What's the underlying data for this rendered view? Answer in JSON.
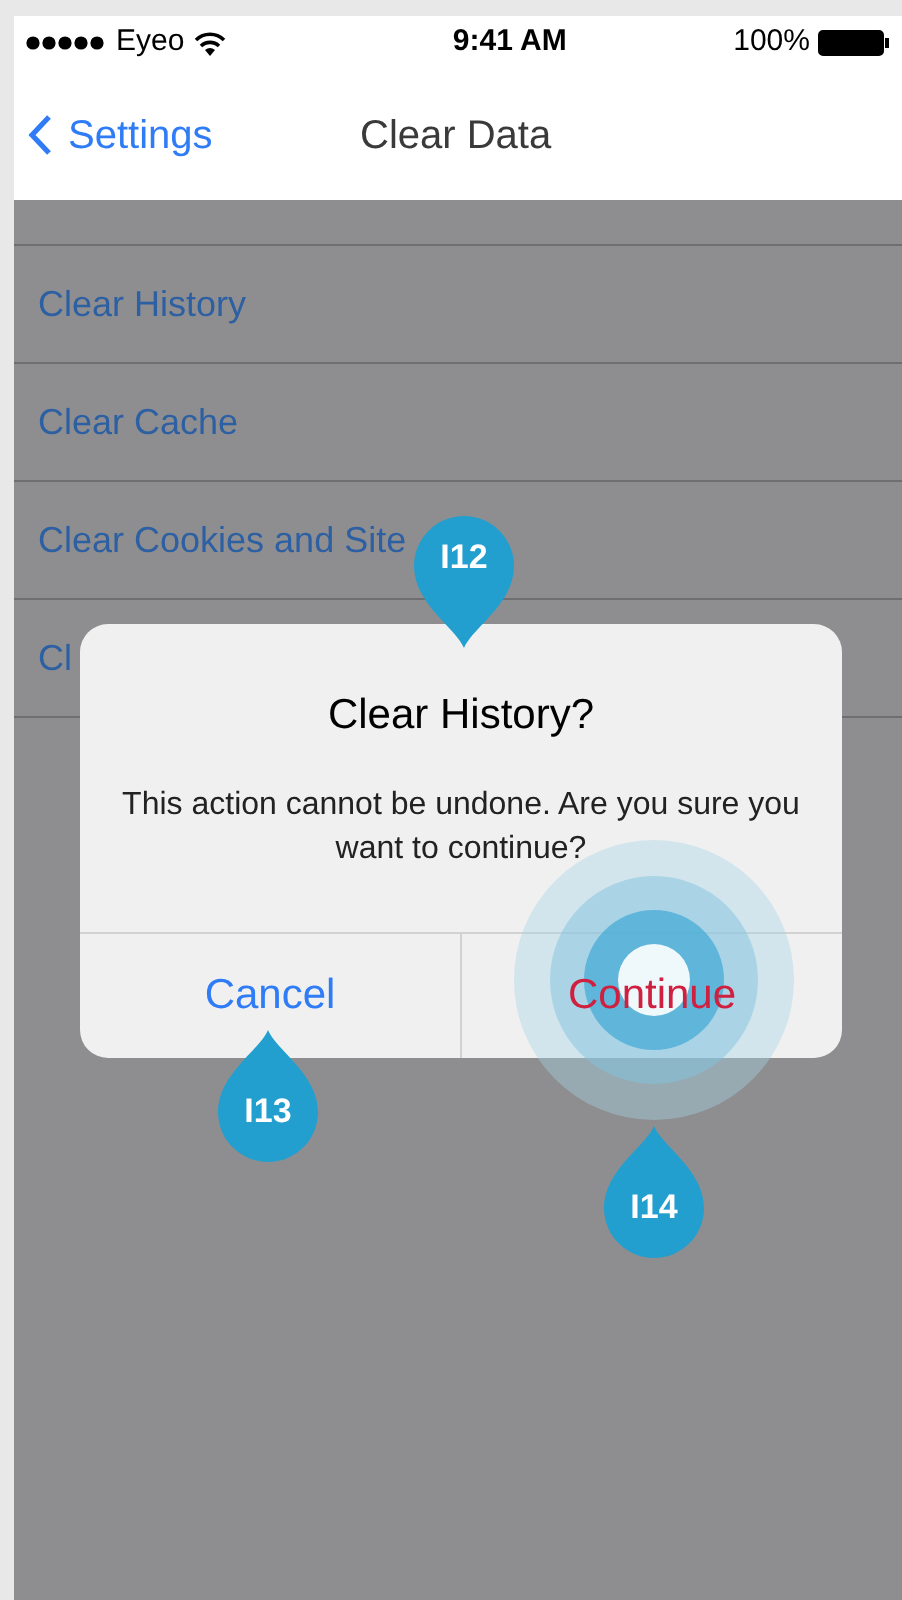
{
  "status_bar": {
    "carrier": "Eyeo",
    "time": "9:41 AM",
    "battery": "100%"
  },
  "nav": {
    "back": "Settings",
    "title": "Clear Data"
  },
  "rows": [
    {
      "label": "Clear History"
    },
    {
      "label": "Clear Cache"
    },
    {
      "label": "Clear Cookies and Site"
    },
    {
      "label": "Cl"
    }
  ],
  "dialog": {
    "title": "Clear History?",
    "message": "This action cannot be undone. Are you sure you want to continue?",
    "buttons": [
      {
        "label": "Cancel",
        "kind": "default",
        "touched": false
      },
      {
        "label": "Continue",
        "kind": "destructive",
        "touched": true
      }
    ]
  },
  "annotations": [
    {
      "label": "I12",
      "kind": "pin-down"
    },
    {
      "label": "I13",
      "kind": "pin-up"
    },
    {
      "label": "I14",
      "kind": "pin-up"
    }
  ]
}
